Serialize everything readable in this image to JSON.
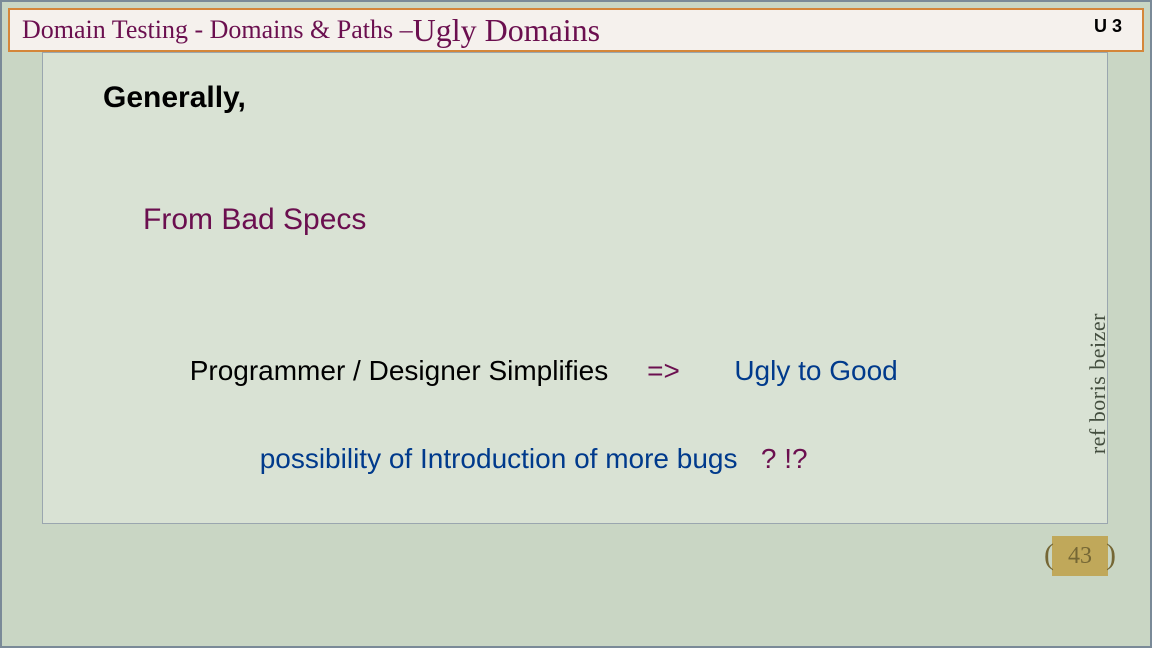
{
  "header": {
    "title_prefix": "Domain Testing  -  Domains & Paths – ",
    "title_main": "Ugly Domains",
    "unit": "U 3"
  },
  "content": {
    "generally": "Generally,",
    "from_bad": "From Bad Specs",
    "line3_part1": "Programmer / Designer Simplifies     ",
    "line3_arrow": "=>",
    "line3_part2": "       Ugly to Good",
    "line4_main": "possibility of Introduction of more bugs   ",
    "line4_ques": "? !?"
  },
  "side_ref": "ref boris beizer",
  "page_number": "43"
}
